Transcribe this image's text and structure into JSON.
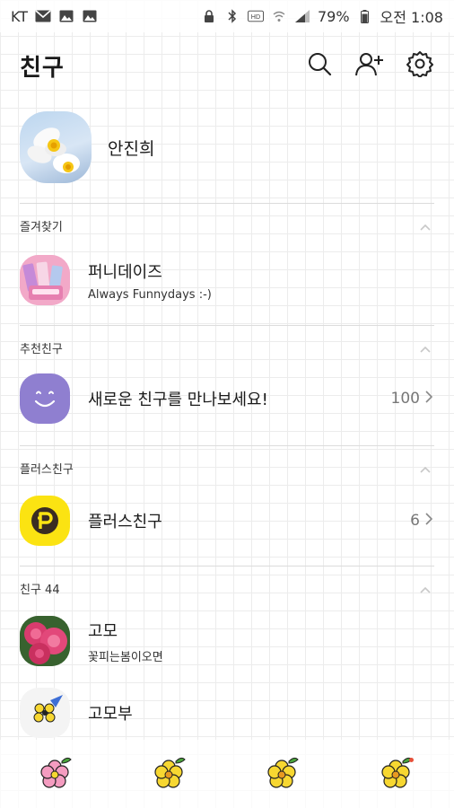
{
  "status_bar": {
    "carrier": "KT",
    "battery": "79%",
    "time": "오전 1:08",
    "icons": [
      "mail-icon",
      "image-icon",
      "image-icon",
      "lock-icon",
      "bluetooth-icon",
      "hd-icon",
      "wifi-icon",
      "signal-icon",
      "battery-icon"
    ]
  },
  "header": {
    "title": "친구",
    "icons": [
      "search-icon",
      "add-friend-icon",
      "settings-icon"
    ]
  },
  "my_profile": {
    "name": "안진희"
  },
  "favorites": {
    "title": "즐겨찾기",
    "items": [
      {
        "name": "퍼니데이즈",
        "status": "Always Funnydays :-)"
      }
    ]
  },
  "recommended": {
    "title": "추천친구",
    "item": {
      "label": "새로운 친구를 만나보세요!",
      "count": "100"
    }
  },
  "plus_friends": {
    "title": "플러스친구",
    "item": {
      "label": "플러스친구",
      "count": "6"
    }
  },
  "friends": {
    "title": "친구 44",
    "items": [
      {
        "name": "고모",
        "status": "꽃피는봄이오면"
      },
      {
        "name": "고모부",
        "status": ""
      }
    ]
  },
  "tab_bar": {
    "tabs": [
      "friends-tab",
      "chats-tab",
      "search-tab",
      "more-tab"
    ],
    "colors": {
      "pink": "#f49cc0",
      "yellow": "#f7d731",
      "leaf": "#4aa43c"
    }
  },
  "colors": {
    "recommend_purple": "#8f7fd0",
    "plus_yellow": "#fbe312"
  }
}
